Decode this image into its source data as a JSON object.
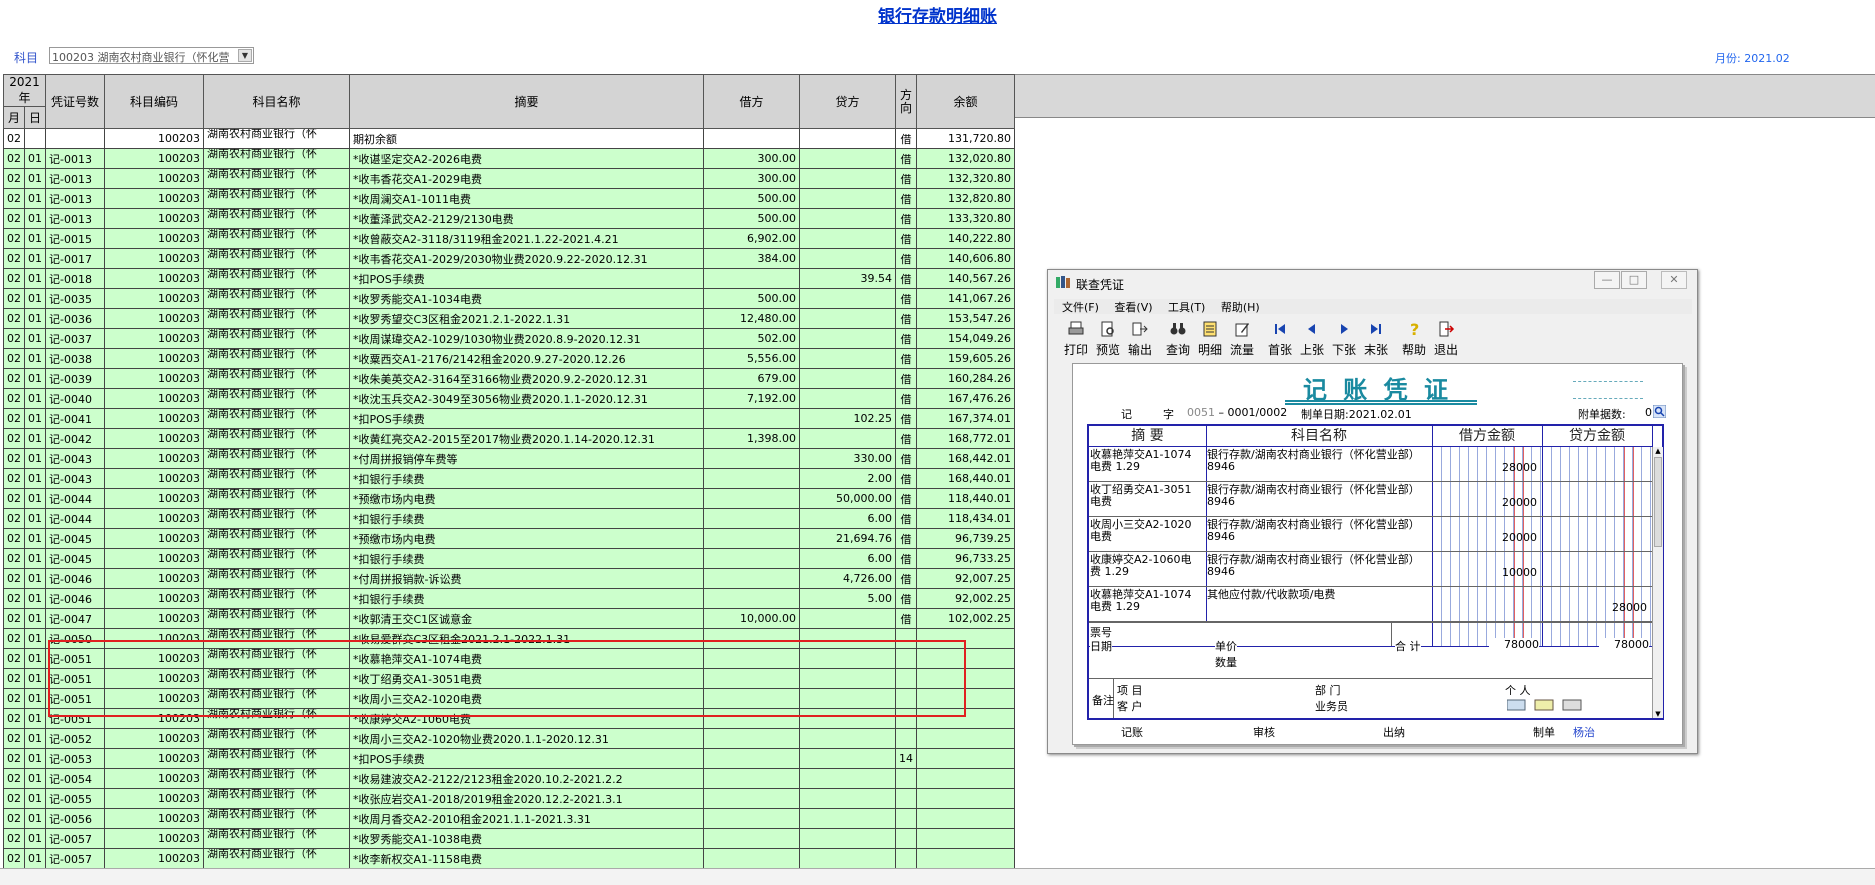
{
  "page": {
    "title": "银行存款明细账",
    "subject_label": "科目",
    "subject_value": "100203 湖南农村商业银行（怀化营",
    "month": "月份: 2021.02"
  },
  "table": {
    "headers": {
      "year": "2021年",
      "month": "月",
      "day": "日",
      "voucher": "凭证号数",
      "code": "科目编码",
      "name": "科目名称",
      "summary": "摘要",
      "debit": "借方",
      "credit": "贷方",
      "direction": "方向",
      "balance": "余额"
    },
    "rows": [
      [
        "02",
        "",
        "",
        "100203",
        "湖南农村商业银行（怀",
        "期初余额",
        "",
        "",
        "借",
        "131,720.80"
      ],
      [
        "02",
        "01",
        "记-0013",
        "100203",
        "湖南农村商业银行（怀",
        "*收谌坚定交A2-2026电费",
        "300.00",
        "",
        "借",
        "132,020.80"
      ],
      [
        "02",
        "01",
        "记-0013",
        "100203",
        "湖南农村商业银行（怀",
        "*收韦香花交A1-2029电费",
        "300.00",
        "",
        "借",
        "132,320.80"
      ],
      [
        "02",
        "01",
        "记-0013",
        "100203",
        "湖南农村商业银行（怀",
        "*收周澜交A1-1011电费",
        "500.00",
        "",
        "借",
        "132,820.80"
      ],
      [
        "02",
        "01",
        "记-0013",
        "100203",
        "湖南农村商业银行（怀",
        "*收董泽武交A2-2129/2130电费",
        "500.00",
        "",
        "借",
        "133,320.80"
      ],
      [
        "02",
        "01",
        "记-0015",
        "100203",
        "湖南农村商业银行（怀",
        "*收曾蔽交A2-3118/3119租金2021.1.22-2021.4.21",
        "6,902.00",
        "",
        "借",
        "140,222.80"
      ],
      [
        "02",
        "01",
        "记-0017",
        "100203",
        "湖南农村商业银行（怀",
        "*收韦香花交A1-2029/2030物业费2020.9.22-2020.12.31",
        "384.00",
        "",
        "借",
        "140,606.80"
      ],
      [
        "02",
        "01",
        "记-0018",
        "100203",
        "湖南农村商业银行（怀",
        "*扣POS手续费",
        "",
        "39.54",
        "借",
        "140,567.26"
      ],
      [
        "02",
        "01",
        "记-0035",
        "100203",
        "湖南农村商业银行（怀",
        "*收罗秀能交A1-1034电费",
        "500.00",
        "",
        "借",
        "141,067.26"
      ],
      [
        "02",
        "01",
        "记-0036",
        "100203",
        "湖南农村商业银行（怀",
        "*收罗秀望交C3区租金2021.2.1-2022.1.31",
        "12,480.00",
        "",
        "借",
        "153,547.26"
      ],
      [
        "02",
        "01",
        "记-0037",
        "100203",
        "湖南农村商业银行（怀",
        "*收周谋瑋交A2-1029/1030物业费2020.8.9-2020.12.31",
        "502.00",
        "",
        "借",
        "154,049.26"
      ],
      [
        "02",
        "01",
        "记-0038",
        "100203",
        "湖南农村商业银行（怀",
        "*收粟西交A1-2176/2142租金2020.9.27-2020.12.26",
        "5,556.00",
        "",
        "借",
        "159,605.26"
      ],
      [
        "02",
        "01",
        "记-0039",
        "100203",
        "湖南农村商业银行（怀",
        "*收朱美英交A2-3164至3166物业费2020.9.2-2020.12.31",
        "679.00",
        "",
        "借",
        "160,284.26"
      ],
      [
        "02",
        "01",
        "记-0040",
        "100203",
        "湖南农村商业银行（怀",
        "*收沈玉兵交A2-3049至3056物业费2020.1.1-2020.12.31",
        "7,192.00",
        "",
        "借",
        "167,476.26"
      ],
      [
        "02",
        "01",
        "记-0041",
        "100203",
        "湖南农村商业银行（怀",
        "*扣POS手续费",
        "",
        "102.25",
        "借",
        "167,374.01"
      ],
      [
        "02",
        "01",
        "记-0042",
        "100203",
        "湖南农村商业银行（怀",
        "*收黄红亮交A2-2015至2017物业费2020.1.14-2020.12.31",
        "1,398.00",
        "",
        "借",
        "168,772.01"
      ],
      [
        "02",
        "01",
        "记-0043",
        "100203",
        "湖南农村商业银行（怀",
        "*付周拼报销停车费等",
        "",
        "330.00",
        "借",
        "168,442.01"
      ],
      [
        "02",
        "01",
        "记-0043",
        "100203",
        "湖南农村商业银行（怀",
        "*扣银行手续费",
        "",
        "2.00",
        "借",
        "168,440.01"
      ],
      [
        "02",
        "01",
        "记-0044",
        "100203",
        "湖南农村商业银行（怀",
        "*预缴市场内电费",
        "",
        "50,000.00",
        "借",
        "118,440.01"
      ],
      [
        "02",
        "01",
        "记-0044",
        "100203",
        "湖南农村商业银行（怀",
        "*扣银行手续费",
        "",
        "6.00",
        "借",
        "118,434.01"
      ],
      [
        "02",
        "01",
        "记-0045",
        "100203",
        "湖南农村商业银行（怀",
        "*预缴市场内电费",
        "",
        "21,694.76",
        "借",
        "96,739.25"
      ],
      [
        "02",
        "01",
        "记-0045",
        "100203",
        "湖南农村商业银行（怀",
        "*扣银行手续费",
        "",
        "6.00",
        "借",
        "96,733.25"
      ],
      [
        "02",
        "01",
        "记-0046",
        "100203",
        "湖南农村商业银行（怀",
        "*付周拼报销款-诉讼费",
        "",
        "4,726.00",
        "借",
        "92,007.25"
      ],
      [
        "02",
        "01",
        "记-0046",
        "100203",
        "湖南农村商业银行（怀",
        "*扣银行手续费",
        "",
        "5.00",
        "借",
        "92,002.25"
      ],
      [
        "02",
        "01",
        "记-0047",
        "100203",
        "湖南农村商业银行（怀",
        "*收郭清王交C1区诚意金",
        "10,000.00",
        "",
        "借",
        "102,002.25"
      ],
      [
        "02",
        "01",
        "记-0050",
        "100203",
        "湖南农村商业银行（怀",
        "*收易爱群交C3区租金2021.2.1-2022.1.31",
        "",
        "",
        "",
        ""
      ],
      [
        "02",
        "01",
        "记-0051",
        "100203",
        "湖南农村商业银行（怀",
        "*收慕艳萍交A1-1074电费",
        "",
        "",
        "",
        ""
      ],
      [
        "02",
        "01",
        "记-0051",
        "100203",
        "湖南农村商业银行（怀",
        "*收丁绍勇交A1-3051电费",
        "",
        "",
        "",
        ""
      ],
      [
        "02",
        "01",
        "记-0051",
        "100203",
        "湖南农村商业银行（怀",
        "*收周小三交A2-1020电费",
        "",
        "",
        "",
        ""
      ],
      [
        "02",
        "01",
        "记-0051",
        "100203",
        "湖南农村商业银行（怀",
        "*收康婷交A2-1060电费",
        "",
        "",
        "",
        ""
      ],
      [
        "02",
        "01",
        "记-0052",
        "100203",
        "湖南农村商业银行（怀",
        "*收周小三交A2-1020物业费2020.1.1-2020.12.31",
        "",
        "",
        "",
        ""
      ],
      [
        "02",
        "01",
        "记-0053",
        "100203",
        "湖南农村商业银行（怀",
        "*扣POS手续费",
        "",
        "",
        "14",
        ""
      ],
      [
        "02",
        "01",
        "记-0054",
        "100203",
        "湖南农村商业银行（怀",
        "*收易建波交A2-2122/2123租金2020.10.2-2021.2.2",
        "",
        "",
        "",
        ""
      ],
      [
        "02",
        "01",
        "记-0055",
        "100203",
        "湖南农村商业银行（怀",
        "*收张应岩交A1-2018/2019租金2020.12.2-2021.3.1",
        "",
        "",
        "",
        ""
      ],
      [
        "02",
        "01",
        "记-0056",
        "100203",
        "湖南农村商业银行（怀",
        "*收周月香交A2-2010租金2021.1.1-2021.3.31",
        "",
        "",
        "",
        ""
      ],
      [
        "02",
        "01",
        "记-0057",
        "100203",
        "湖南农村商业银行（怀",
        "*收罗秀能交A1-1038电费",
        "",
        "",
        "",
        ""
      ],
      [
        "02",
        "01",
        "记-0057",
        "100203",
        "湖南农村商业银行（怀",
        "*收李新权交A1-1158电费",
        "",
        "",
        "",
        ""
      ]
    ]
  },
  "dialog": {
    "title": "联查凭证",
    "menu": [
      "文件(F)",
      "查看(V)",
      "工具(T)",
      "帮助(H)"
    ],
    "toolbar": [
      "打印",
      "预览",
      "输出",
      "查询",
      "明细",
      "流量",
      "首张",
      "上张",
      "下张",
      "末张",
      "帮助",
      "退出"
    ],
    "voucher": {
      "title": "记 账 凭 证",
      "type_label": "记",
      "zi": "字",
      "number": "0051",
      "page": "0001/0002",
      "date": "制单日期:2021.02.01",
      "attach_label": "附单据数:",
      "attach_value": "0",
      "col_summary": "摘 要",
      "col_subject": "科目名称",
      "col_debit": "借方金额",
      "col_credit": "贷方金额",
      "entries": [
        {
          "summary": "收慕艳萍交A1-1074电费  1.29",
          "subject": "银行存款/湖南农村商业银行（怀化营业部）8946",
          "debit": "28000",
          "credit": ""
        },
        {
          "summary": "收丁绍勇交A1-3051电费",
          "subject": "银行存款/湖南农村商业银行（怀化营业部）8946",
          "debit": "20000",
          "credit": ""
        },
        {
          "summary": "收周小三交A2-1020电费",
          "subject": "银行存款/湖南农村商业银行（怀化营业部）8946",
          "debit": "20000",
          "credit": ""
        },
        {
          "summary": "收康婷交A2-1060电费  1.29",
          "subject": "银行存款/湖南农村商业银行（怀化营业部）8946",
          "debit": "10000",
          "credit": ""
        },
        {
          "summary": "收慕艳萍交A1-1074电费  1.29",
          "subject": "其他应付款/代收款项/电费",
          "debit": "",
          "credit": "28000"
        }
      ],
      "ticket_no": "票号",
      "ticket_date": "日期",
      "unit_price": "单价",
      "quantity": "数量",
      "total_label": "合 计",
      "total_debit": "78000",
      "total_credit": "78000",
      "remark": "备注",
      "project": "项  目",
      "customer": "客  户",
      "dept": "部  门",
      "person": "个  人",
      "salesman": "业务员",
      "footer_post": "记账",
      "footer_audit": "审核",
      "footer_cashier": "出纳",
      "footer_maker_label": "制单",
      "footer_maker": "杨治"
    }
  },
  "colors": {
    "row_bg": "#ccffcc",
    "header_bg": "#d4d4d4",
    "highlight": "#e02020",
    "voucher_title": "#1a8aa0"
  }
}
